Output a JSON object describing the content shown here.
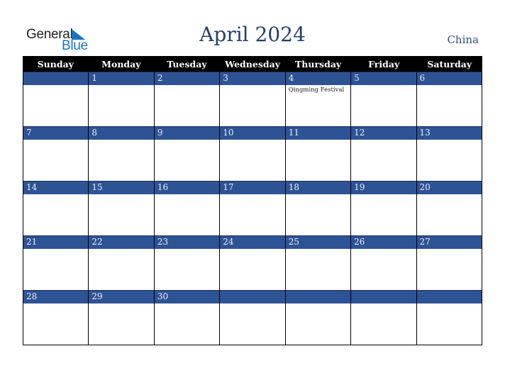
{
  "logo": {
    "line1": "General",
    "line2": "Blue",
    "icon": "triangle-flag-icon",
    "color": "#1a73c0"
  },
  "title": "April 2024",
  "country": "China",
  "weekdays": [
    "Sunday",
    "Monday",
    "Tuesday",
    "Wednesday",
    "Thursday",
    "Friday",
    "Saturday"
  ],
  "weeks": [
    {
      "days": [
        {
          "date": "",
          "event": ""
        },
        {
          "date": "1",
          "event": ""
        },
        {
          "date": "2",
          "event": ""
        },
        {
          "date": "3",
          "event": ""
        },
        {
          "date": "4",
          "event": "Qingming Festival"
        },
        {
          "date": "5",
          "event": ""
        },
        {
          "date": "6",
          "event": ""
        }
      ]
    },
    {
      "days": [
        {
          "date": "7",
          "event": ""
        },
        {
          "date": "8",
          "event": ""
        },
        {
          "date": "9",
          "event": ""
        },
        {
          "date": "10",
          "event": ""
        },
        {
          "date": "11",
          "event": ""
        },
        {
          "date": "12",
          "event": ""
        },
        {
          "date": "13",
          "event": ""
        }
      ]
    },
    {
      "days": [
        {
          "date": "14",
          "event": ""
        },
        {
          "date": "15",
          "event": ""
        },
        {
          "date": "16",
          "event": ""
        },
        {
          "date": "17",
          "event": ""
        },
        {
          "date": "18",
          "event": ""
        },
        {
          "date": "19",
          "event": ""
        },
        {
          "date": "20",
          "event": ""
        }
      ]
    },
    {
      "days": [
        {
          "date": "21",
          "event": ""
        },
        {
          "date": "22",
          "event": ""
        },
        {
          "date": "23",
          "event": ""
        },
        {
          "date": "24",
          "event": ""
        },
        {
          "date": "25",
          "event": ""
        },
        {
          "date": "26",
          "event": ""
        },
        {
          "date": "27",
          "event": ""
        }
      ]
    },
    {
      "days": [
        {
          "date": "28",
          "event": ""
        },
        {
          "date": "29",
          "event": ""
        },
        {
          "date": "30",
          "event": ""
        },
        {
          "date": "",
          "event": ""
        },
        {
          "date": "",
          "event": ""
        },
        {
          "date": "",
          "event": ""
        },
        {
          "date": "",
          "event": ""
        }
      ]
    }
  ],
  "colors": {
    "header_bg": "#000000",
    "date_band": "#2e5394",
    "title": "#253f6a"
  }
}
